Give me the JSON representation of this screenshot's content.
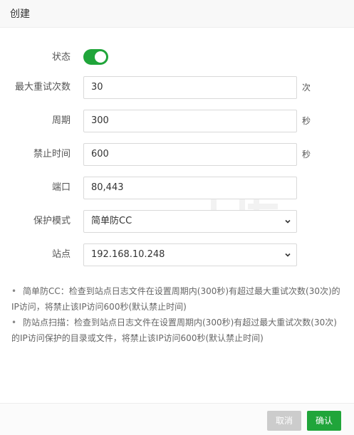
{
  "dialog": {
    "title": "创建"
  },
  "form": {
    "status": {
      "label": "状态",
      "enabled": true
    },
    "max_retries": {
      "label": "最大重试次数",
      "value": "30",
      "unit": "次"
    },
    "period": {
      "label": "周期",
      "value": "300",
      "unit": "秒"
    },
    "ban_time": {
      "label": "禁止时间",
      "value": "600",
      "unit": "秒"
    },
    "port": {
      "label": "端口",
      "value": "80,443"
    },
    "protect_mode": {
      "label": "保护模式",
      "selected": "简单防CC"
    },
    "site": {
      "label": "站点",
      "selected": "192.168.10.248"
    }
  },
  "notes": [
    {
      "bullet": "•",
      "line1": "简单防CC：检查到站点日志文件在设置周期内(300秒)有超过最大重试次数(30次)的",
      "line2": "IP访问，将禁止该IP访问600秒(默认禁止时间)"
    },
    {
      "bullet": "•",
      "line1": "防站点扫描：检查到站点日志文件在设置周期内(300秒)有超过最大重试次数(30次)",
      "line2": "的IP访问保护的目录或文件，将禁止该IP访问600秒(默认禁止时间)"
    }
  ],
  "footer": {
    "cancel_label": "取消",
    "confirm_label": "确认"
  },
  "colors": {
    "accent": "#20a53a",
    "disabled_button": "#cccccc"
  },
  "icons": {
    "select_chevron": "chevron-down-icon"
  }
}
